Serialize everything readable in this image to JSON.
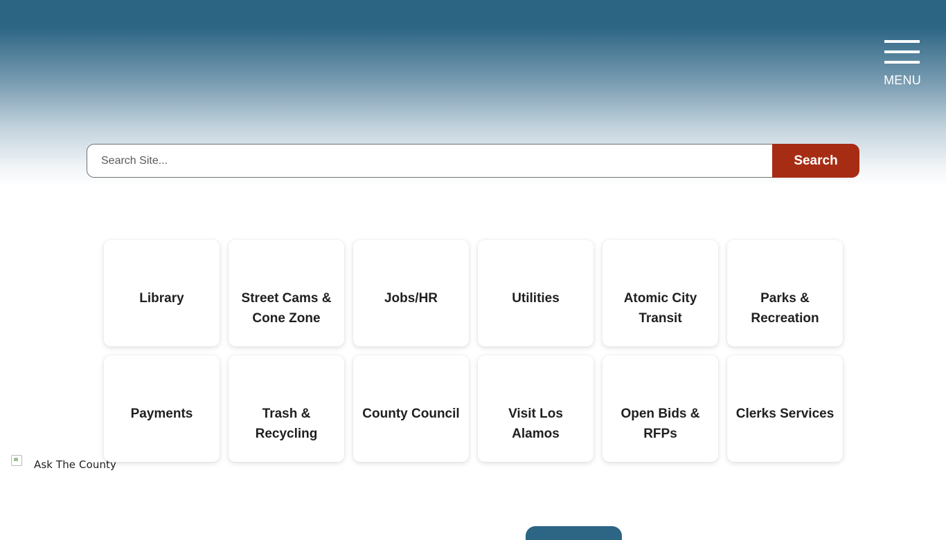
{
  "header": {
    "menu_label": "MENU"
  },
  "search": {
    "placeholder": "Search Site...",
    "button_label": "Search"
  },
  "quick_links": [
    {
      "label": "Library"
    },
    {
      "label": "Street Cams & Cone Zone"
    },
    {
      "label": "Jobs/HR"
    },
    {
      "label": "Utilities"
    },
    {
      "label": "Atomic City Transit"
    },
    {
      "label": "Parks & Recreation"
    },
    {
      "label": "Payments"
    },
    {
      "label": "Trash & Recycling"
    },
    {
      "label": "County Council"
    },
    {
      "label": "Visit Los Alamos"
    },
    {
      "label": "Open Bids & RFPs"
    },
    {
      "label": "Clerks Services"
    }
  ],
  "ask_widget": {
    "label": "Ask The County",
    "icon": "broken-image-icon"
  },
  "colors": {
    "header_top": "#2b6583",
    "search_button": "#a62d14",
    "accent": "#2d6584"
  }
}
